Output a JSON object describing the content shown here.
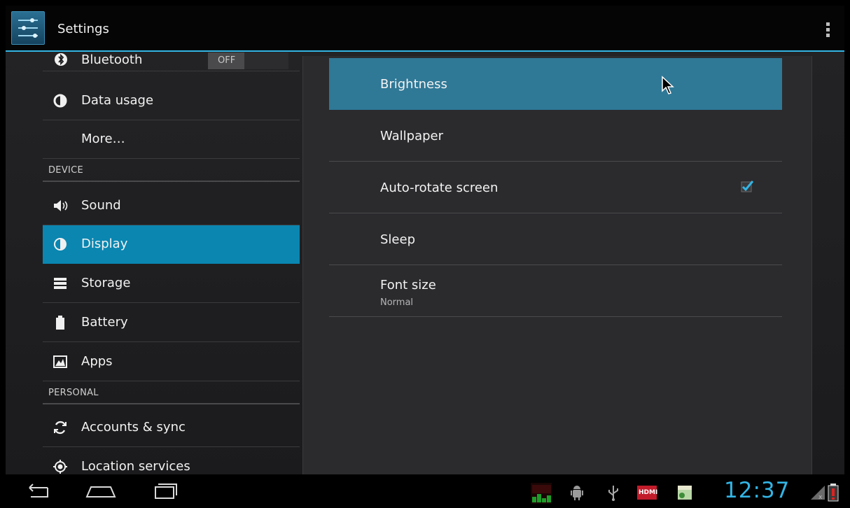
{
  "app": {
    "title": "Settings",
    "icon": "settings-sliders-icon"
  },
  "accent_color": "#33b5e5",
  "sidebar": {
    "items": [
      {
        "type": "item",
        "icon": "bluetooth-icon",
        "label": "Bluetooth",
        "toggle": "OFF"
      },
      {
        "type": "item",
        "icon": "data-usage-icon",
        "label": "Data usage"
      },
      {
        "type": "item",
        "icon": "",
        "label": "More…"
      },
      {
        "type": "section",
        "label": "DEVICE"
      },
      {
        "type": "item",
        "icon": "sound-icon",
        "label": "Sound"
      },
      {
        "type": "item",
        "icon": "display-icon",
        "label": "Display",
        "selected": true
      },
      {
        "type": "item",
        "icon": "storage-icon",
        "label": "Storage"
      },
      {
        "type": "item",
        "icon": "battery-icon",
        "label": "Battery"
      },
      {
        "type": "item",
        "icon": "apps-icon",
        "label": "Apps"
      },
      {
        "type": "section",
        "label": "PERSONAL"
      },
      {
        "type": "item",
        "icon": "sync-icon",
        "label": "Accounts & sync"
      },
      {
        "type": "item",
        "icon": "location-icon",
        "label": "Location services"
      }
    ]
  },
  "display": {
    "prefs": [
      {
        "title": "Brightness",
        "highlighted": true
      },
      {
        "title": "Wallpaper"
      },
      {
        "title": "Auto-rotate screen",
        "checked": true
      },
      {
        "title": "Sleep"
      },
      {
        "title": "Font size",
        "summary": "Normal"
      }
    ]
  },
  "navbar": {
    "buttons": [
      "back-icon",
      "home-icon",
      "recent-apps-icon"
    ]
  },
  "status": {
    "time": "12:37",
    "icons": [
      "level-meter-icon",
      "android-debug-icon",
      "usb-icon",
      "hdmi-icon",
      "app-notification-icon",
      "signal-icon",
      "battery-alert-icon"
    ],
    "hdmi_label": "HDMI"
  }
}
